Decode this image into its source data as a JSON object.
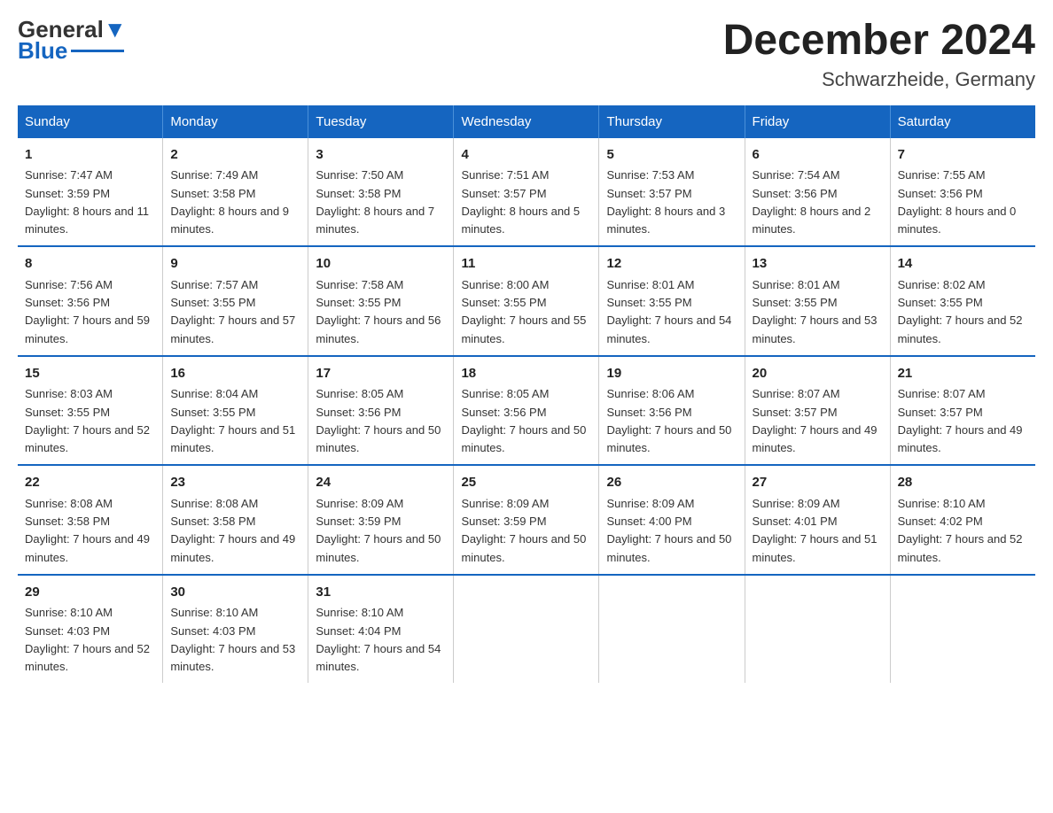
{
  "logo": {
    "text_general": "General",
    "text_blue": "Blue"
  },
  "title": "December 2024",
  "subtitle": "Schwarzheide, Germany",
  "days_of_week": [
    "Sunday",
    "Monday",
    "Tuesday",
    "Wednesday",
    "Thursday",
    "Friday",
    "Saturday"
  ],
  "weeks": [
    [
      {
        "num": "1",
        "sunrise": "7:47 AM",
        "sunset": "3:59 PM",
        "daylight": "8 hours and 11 minutes."
      },
      {
        "num": "2",
        "sunrise": "7:49 AM",
        "sunset": "3:58 PM",
        "daylight": "8 hours and 9 minutes."
      },
      {
        "num": "3",
        "sunrise": "7:50 AM",
        "sunset": "3:58 PM",
        "daylight": "8 hours and 7 minutes."
      },
      {
        "num": "4",
        "sunrise": "7:51 AM",
        "sunset": "3:57 PM",
        "daylight": "8 hours and 5 minutes."
      },
      {
        "num": "5",
        "sunrise": "7:53 AM",
        "sunset": "3:57 PM",
        "daylight": "8 hours and 3 minutes."
      },
      {
        "num": "6",
        "sunrise": "7:54 AM",
        "sunset": "3:56 PM",
        "daylight": "8 hours and 2 minutes."
      },
      {
        "num": "7",
        "sunrise": "7:55 AM",
        "sunset": "3:56 PM",
        "daylight": "8 hours and 0 minutes."
      }
    ],
    [
      {
        "num": "8",
        "sunrise": "7:56 AM",
        "sunset": "3:56 PM",
        "daylight": "7 hours and 59 minutes."
      },
      {
        "num": "9",
        "sunrise": "7:57 AM",
        "sunset": "3:55 PM",
        "daylight": "7 hours and 57 minutes."
      },
      {
        "num": "10",
        "sunrise": "7:58 AM",
        "sunset": "3:55 PM",
        "daylight": "7 hours and 56 minutes."
      },
      {
        "num": "11",
        "sunrise": "8:00 AM",
        "sunset": "3:55 PM",
        "daylight": "7 hours and 55 minutes."
      },
      {
        "num": "12",
        "sunrise": "8:01 AM",
        "sunset": "3:55 PM",
        "daylight": "7 hours and 54 minutes."
      },
      {
        "num": "13",
        "sunrise": "8:01 AM",
        "sunset": "3:55 PM",
        "daylight": "7 hours and 53 minutes."
      },
      {
        "num": "14",
        "sunrise": "8:02 AM",
        "sunset": "3:55 PM",
        "daylight": "7 hours and 52 minutes."
      }
    ],
    [
      {
        "num": "15",
        "sunrise": "8:03 AM",
        "sunset": "3:55 PM",
        "daylight": "7 hours and 52 minutes."
      },
      {
        "num": "16",
        "sunrise": "8:04 AM",
        "sunset": "3:55 PM",
        "daylight": "7 hours and 51 minutes."
      },
      {
        "num": "17",
        "sunrise": "8:05 AM",
        "sunset": "3:56 PM",
        "daylight": "7 hours and 50 minutes."
      },
      {
        "num": "18",
        "sunrise": "8:05 AM",
        "sunset": "3:56 PM",
        "daylight": "7 hours and 50 minutes."
      },
      {
        "num": "19",
        "sunrise": "8:06 AM",
        "sunset": "3:56 PM",
        "daylight": "7 hours and 50 minutes."
      },
      {
        "num": "20",
        "sunrise": "8:07 AM",
        "sunset": "3:57 PM",
        "daylight": "7 hours and 49 minutes."
      },
      {
        "num": "21",
        "sunrise": "8:07 AM",
        "sunset": "3:57 PM",
        "daylight": "7 hours and 49 minutes."
      }
    ],
    [
      {
        "num": "22",
        "sunrise": "8:08 AM",
        "sunset": "3:58 PM",
        "daylight": "7 hours and 49 minutes."
      },
      {
        "num": "23",
        "sunrise": "8:08 AM",
        "sunset": "3:58 PM",
        "daylight": "7 hours and 49 minutes."
      },
      {
        "num": "24",
        "sunrise": "8:09 AM",
        "sunset": "3:59 PM",
        "daylight": "7 hours and 50 minutes."
      },
      {
        "num": "25",
        "sunrise": "8:09 AM",
        "sunset": "3:59 PM",
        "daylight": "7 hours and 50 minutes."
      },
      {
        "num": "26",
        "sunrise": "8:09 AM",
        "sunset": "4:00 PM",
        "daylight": "7 hours and 50 minutes."
      },
      {
        "num": "27",
        "sunrise": "8:09 AM",
        "sunset": "4:01 PM",
        "daylight": "7 hours and 51 minutes."
      },
      {
        "num": "28",
        "sunrise": "8:10 AM",
        "sunset": "4:02 PM",
        "daylight": "7 hours and 52 minutes."
      }
    ],
    [
      {
        "num": "29",
        "sunrise": "8:10 AM",
        "sunset": "4:03 PM",
        "daylight": "7 hours and 52 minutes."
      },
      {
        "num": "30",
        "sunrise": "8:10 AM",
        "sunset": "4:03 PM",
        "daylight": "7 hours and 53 minutes."
      },
      {
        "num": "31",
        "sunrise": "8:10 AM",
        "sunset": "4:04 PM",
        "daylight": "7 hours and 54 minutes."
      },
      null,
      null,
      null,
      null
    ]
  ]
}
